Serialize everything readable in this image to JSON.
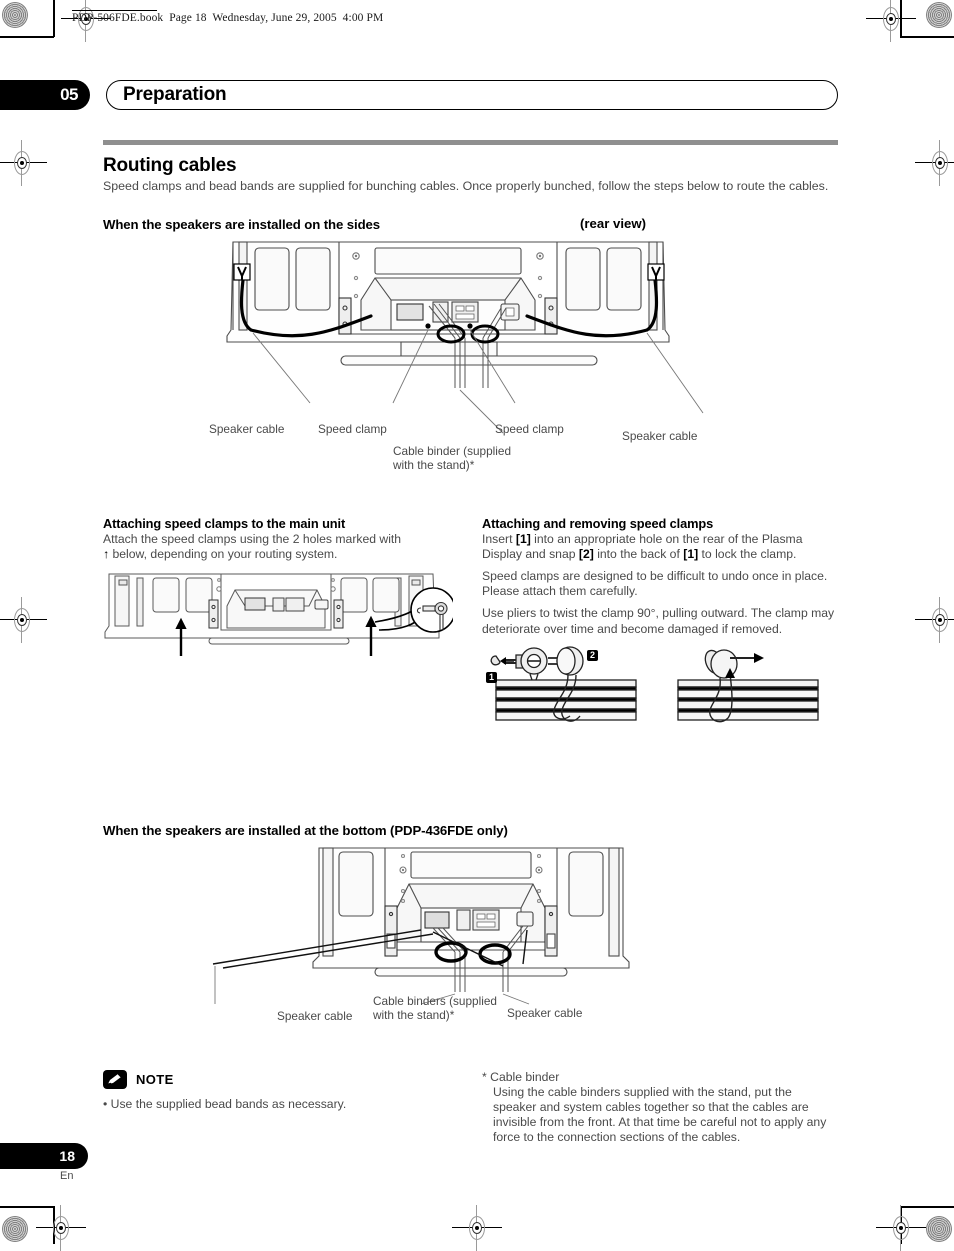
{
  "file_header": "PDP-506FDE.book  Page 18  Wednesday, June 29, 2005  4:00 PM",
  "chapter": {
    "number": "05",
    "title": "Preparation"
  },
  "section": {
    "title": "Routing cables",
    "intro": "Speed clamps and bead bands are supplied for bunching cables. Once properly bunched, follow the steps below to route the cables."
  },
  "figure_sides": {
    "heading": "When the speakers are installed on the sides",
    "view_label": "(rear view)",
    "labels": {
      "speaker_cable_left": "Speaker cable",
      "speed_clamp_left": "Speed clamp",
      "cable_binder": "Cable binder (supplied\nwith the stand)*",
      "speed_clamp_right": "Speed clamp",
      "speaker_cable_right": "Speaker cable"
    }
  },
  "attaching_clamps": {
    "heading": "Attaching speed clamps to the main unit",
    "text_before_dagger": "Attach the speed clamps using the 2 holes marked with",
    "dagger": "↑",
    "text_after_dagger": "below, depending on your routing system."
  },
  "attaching_removing": {
    "heading": "Attaching and removing speed clamps",
    "para1_a": "Insert",
    "badge1": "1",
    "para1_b": "into an appropriate hole on the rear of the Plasma Display and snap",
    "badge2": "2",
    "para1_c": "into the back of",
    "badge3": "1",
    "para1_d": "to lock the clamp.",
    "para2": "Speed clamps are designed to be difficult to undo once in place. Please attach them carefully.",
    "para3": "Use pliers to twist the clamp 90°, pulling outward. The clamp may deteriorate over time and become damaged if removed.",
    "diagram_badge_1": "1",
    "diagram_badge_2": "2"
  },
  "figure_bottom": {
    "heading": "When the speakers are installed at the bottom (PDP-436FDE only)",
    "labels": {
      "speaker_cable_left": "Speaker cable",
      "cable_binders": "Cable binders (supplied\nwith the stand)*",
      "speaker_cable_right": "Speaker cable"
    }
  },
  "note": {
    "label": "NOTE",
    "icon": "pencil-icon",
    "items": [
      "• Use the supplied bead bands as necessary."
    ]
  },
  "footnote": {
    "marker": "*",
    "title": "Cable binder",
    "body": "Using the cable binders supplied with the stand, put the speaker and system cables together so that the cables are invisible from the front. At that time be careful not to apply any force to the connection sections of the cables."
  },
  "footer": {
    "page_number": "18",
    "language": "En"
  },
  "colors": {
    "rule_gray": "#8f8f8f",
    "body_text": "#4a4a4a",
    "heading_black": "#000000"
  }
}
